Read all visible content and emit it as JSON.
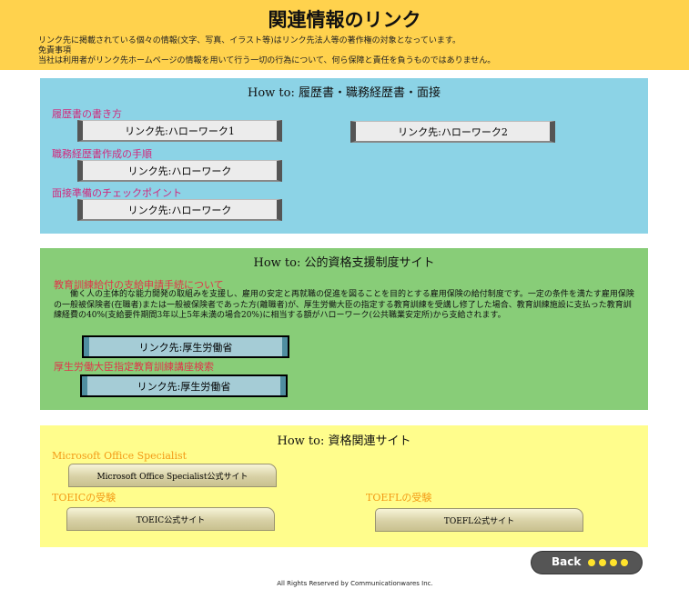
{
  "header": {
    "title": "関連情報のリンク",
    "line1": "リンク先に掲載されている個々の情報(文字、写真、イラスト等)はリンク先法人等の著作権の対象となっています。",
    "line2": "免責事項",
    "line3": "当社は利用者がリンク先ホームページの情報を用いて行う一切の行為について、何ら保障と責任を負うものではありません。",
    "color": "#ffd24d"
  },
  "section_resume": {
    "title": "How to: 履歴書・職務経歴書・面接",
    "label_resume": "履歴書の書き方",
    "btn_hw1": "リンク先:ハローワーク1",
    "btn_hw2": "リンク先:ハローワーク2",
    "label_career": "職務経歴書作成の手順",
    "btn_career": "リンク先:ハローワーク",
    "label_interview": "面接準備のチェックポイント",
    "btn_interview": "リンク先:ハローワーク",
    "color": "#8cd3e6"
  },
  "section_public": {
    "title": "How to: 公的資格支援制度サイト",
    "label_benefit": "教育訓練給付の支給申請手続について",
    "desc": "働く人の主体的な能力開発の取組みを支援し、雇用の安定と再就職の促進を図ることを目的とする雇用保険の給付制度です。一定の条件を満たす雇用保険の一般被保険者(在職者)または一般被保険者であった方(離職者)が、厚生労働大臣の指定する教育訓練を受講し修了した場合、教育訓練施設に支払った教育訓練経費の40%(支給要件期間3年以上5年未満の場合20%)に相当する額がハローワーク(公共職業安定所)から支給されます。",
    "btn_mhlw1": "リンク先:厚生労働省",
    "label_search": "厚生労働大臣指定教育訓練講座検索",
    "btn_mhlw2": "リンク先:厚生労働省",
    "color": "#88cd78"
  },
  "section_cert": {
    "title": "How to: 資格関連サイト",
    "label_mos": "Microsoft Office Specialist",
    "btn_mos": "Microsoft Office Specialist公式サイト",
    "label_toeic": "TOEICの受験",
    "btn_toeic": "TOEIC公式サイト",
    "label_toefl": "TOEFLの受験",
    "btn_toefl": "TOEFL公式サイト",
    "color": "#fffd8c"
  },
  "nav": {
    "back_label": "Back"
  },
  "footer": {
    "text": "All Rights Reserved by Communicationwares Inc."
  }
}
